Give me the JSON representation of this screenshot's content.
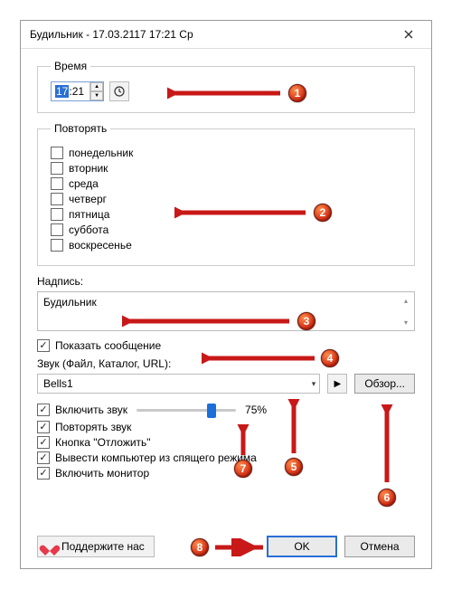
{
  "title": "Будильник - 17.03.2117 17:21 Ср",
  "groups": {
    "time": "Время",
    "repeat": "Повторять"
  },
  "time": {
    "hh": "17",
    "sep": ":",
    "mm": "21"
  },
  "days": [
    {
      "label": "понедельник",
      "checked": false
    },
    {
      "label": "вторник",
      "checked": false
    },
    {
      "label": "среда",
      "checked": false
    },
    {
      "label": "четверг",
      "checked": false
    },
    {
      "label": "пятница",
      "checked": false
    },
    {
      "label": "суббота",
      "checked": false
    },
    {
      "label": "воскресенье",
      "checked": false
    }
  ],
  "message": {
    "label": "Надпись:",
    "value": "Будильник"
  },
  "show_message": {
    "label": "Показать сообщение",
    "checked": true
  },
  "sound": {
    "label": "Звук (Файл, Каталог, URL):",
    "selected": "Bells1",
    "browse": "Обзор..."
  },
  "enable_sound": {
    "label": "Включить звук",
    "checked": true
  },
  "volume_pct": "75%",
  "repeat_sound": {
    "label": "Повторять звук",
    "checked": true
  },
  "snooze_button": {
    "label": "Кнопка \"Отложить\"",
    "checked": true
  },
  "wake_pc": {
    "label": "Вывести компьютер из спящего режима",
    "checked": true
  },
  "enable_monitor": {
    "label": "Включить монитор",
    "checked": true
  },
  "support": "Поддержите нас",
  "ok": "OK",
  "cancel": "Отмена",
  "badges": [
    "1",
    "2",
    "3",
    "4",
    "5",
    "6",
    "7",
    "8"
  ]
}
